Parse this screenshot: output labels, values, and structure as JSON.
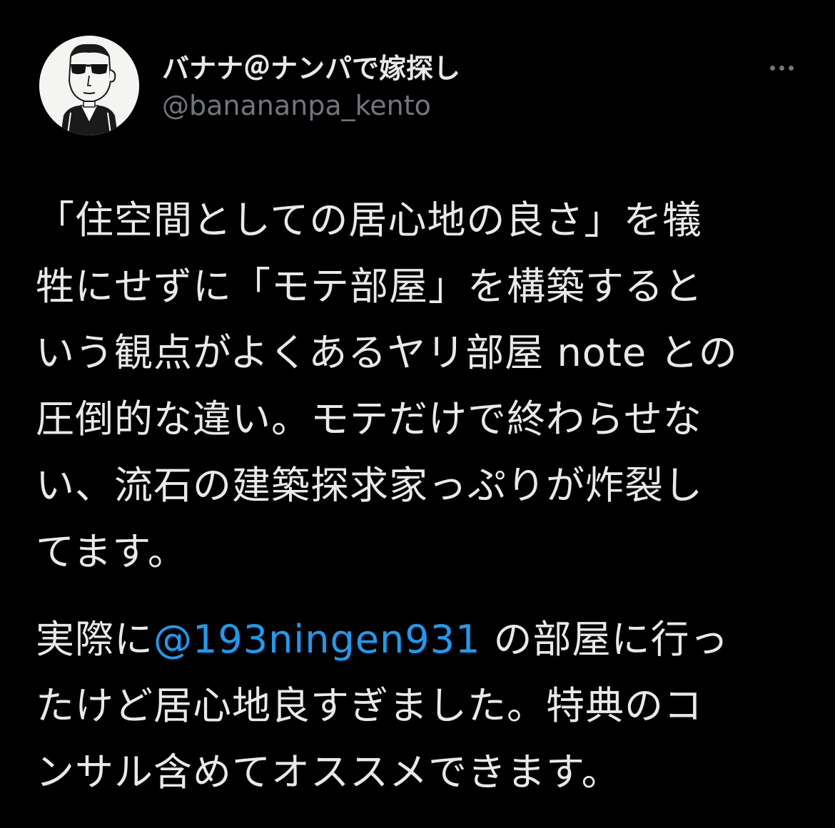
{
  "tweet": {
    "author": {
      "display_name": "バナナ＠ナンパで嫁探し",
      "handle": "@banananpa_kento",
      "avatar_icon": "cartoon-man-sunglasses-avatar"
    },
    "more_icon": "more-dots-icon",
    "paragraph1": {
      "lines": [
        "「住空間としての居心地の良さ」を犠",
        "牲にせずに「モテ部屋」を構築すると",
        "いう観点がよくあるヤリ部屋 note との",
        "圧倒的な違い。モテだけで終わらせな",
        "い、流石の建築探求家っぷりが炸裂し",
        "てます。"
      ]
    },
    "paragraph2": {
      "line1_prefix": "実際に",
      "mention": "@193ningen931",
      "line1_suffix": " の部屋に行っ",
      "line2": "たけど居心地良すぎました。特典のコ",
      "line3": "ンサル含めてオススメできます。"
    }
  },
  "colors": {
    "background": "#000000",
    "text": "#e7e9ea",
    "secondary": "#71767b",
    "link": "#1d9bf0"
  }
}
